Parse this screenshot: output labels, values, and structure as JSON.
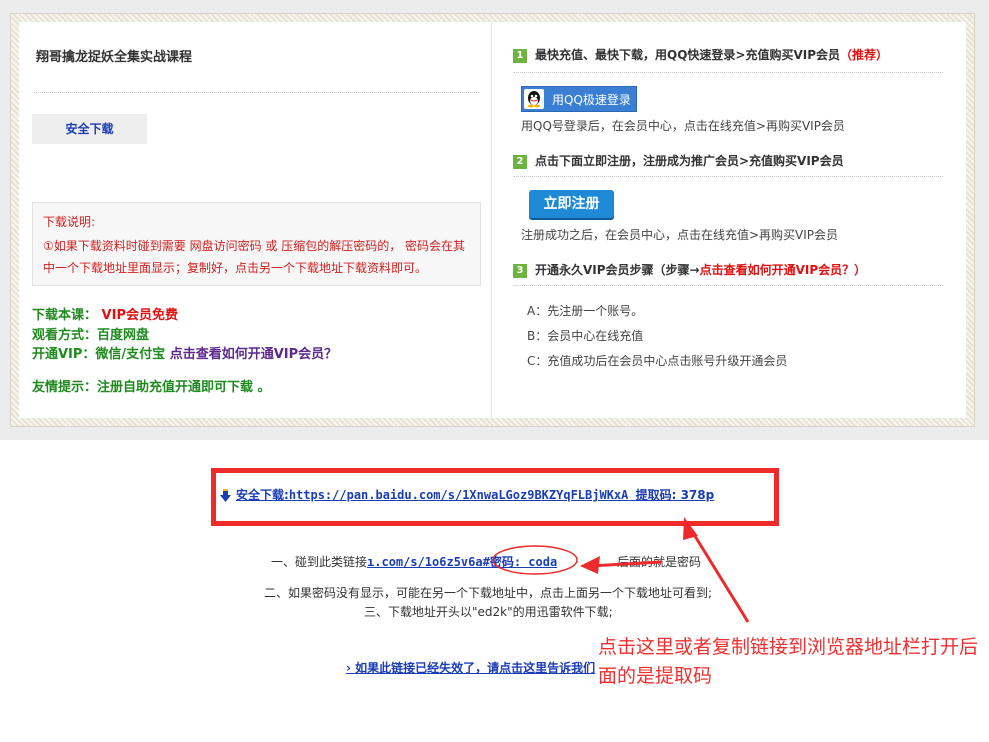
{
  "course": {
    "title": "翔哥擒龙捉妖全集实战课程"
  },
  "left": {
    "safe_download_button": "安全下载",
    "note": {
      "title": "下载说明:",
      "line1": "①如果下载资料时碰到需要 网盘访问密码 或 压缩包的解压密码的， 密码会在其",
      "line2": "中一个下载地址里面显示；复制好，点击另一个下载地址下载资料即可。"
    },
    "download_this_label": "下载本课：",
    "download_this_value": "VIP会员免费",
    "watch_mode": "观看方式：百度网盘",
    "open_vip_label": "开通VIP：微信/支付宝",
    "open_vip_link": "点击查看如何开通VIP会员？",
    "friendly_tip": "友情提示：注册自助充值开通即可下载 。"
  },
  "right": {
    "step1_num": "1",
    "step1_text": "最快充值、最快下载，用QQ快速登录>充值购买VIP会员",
    "step1_recommend": "（推荐）",
    "qq_button": "用QQ极速登录",
    "step1_desc": "用QQ号登录后，在会员中心，点击在线充值>再购买VIP会员",
    "step2_num": "2",
    "step2_text": "点击下面立即注册，注册成为推广会员>充值购买VIP会员",
    "register_button": "立即注册",
    "step2_desc": "注册成功之后，在会员中心，点击在线充值>再购买VIP会员",
    "step3_num": "3",
    "step3_text": "开通永久VIP会员步骤（步骤→",
    "step3_link": "点击查看如何开通VIP会员？）",
    "a": "A：先注册一个账号。",
    "b": "B：会员中心在线充值",
    "c": "C：充值成功后在会员中心点击账号升级开通会员"
  },
  "download": {
    "label": "安全下载:",
    "url": "https://pan.baidu.com/s/1XnwaLGoz9BKZYqFLBjWKxA",
    "code_text": "提取码: 378p"
  },
  "tips": {
    "t1_prefix": "一、碰到此类链接",
    "t1_example": "ı.com/s/1o6z5v6a#密码: coda",
    "t1_suffix": "后面的就是密码",
    "t2": "二、如果密码没有显示，可能在另一个下载地址中，点击上面另一个下载地址可看到;",
    "t3": "三、下载地址开头以\"ed2k\"的用迅雷软件下载;"
  },
  "report_link": "› 如果此链接已经失效了，请点击这里告诉我们",
  "annotation": "点击这里或者复制链接到浏览器地址栏打开后面的是提取码",
  "colors": {
    "accent_red": "#ee2a2a",
    "link_blue": "#1a3db6",
    "green": "#1f8a1f",
    "step_green": "#6db33f"
  }
}
